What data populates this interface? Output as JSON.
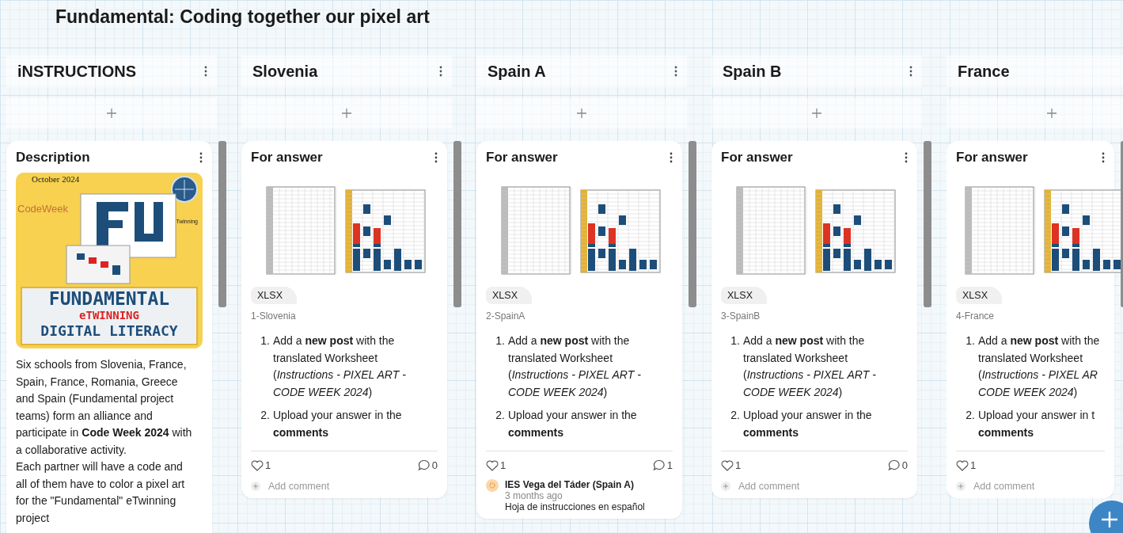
{
  "board": {
    "title": "Fundamental: Coding together our pixel art"
  },
  "columns": [
    {
      "title": "iNSTRUCTIONS",
      "posts": [
        {
          "kind": "description",
          "title": "Description",
          "poster": {
            "date": "October 2024",
            "brand": "CodeWeek",
            "badge": "Twinning",
            "headline": "FUNDAMENTAL",
            "subline": "eTWINNING",
            "footer": "DIGITAL LITERACY"
          },
          "body": "Six schools from Slovenia, France, Spain, France, Romania, Greece and Spain (Fundamental project teams) form an alliance and participate in **Code Week 2024** with a collaborative activity.\nEach partner will have a code and all of them have to color a pixel art for the \"Fundamental\" eTwinning project"
        }
      ]
    },
    {
      "title": "Slovenia",
      "posts": [
        {
          "kind": "answer",
          "title": "For answer",
          "attachment": "XLSX",
          "caption": "1-Slovenia",
          "steps": [
            {
              "number": "1.",
              "text": "Add a **new post** with the translated Worksheet (*Instructions - PIXEL ART - CODE WEEK 2024*)"
            },
            {
              "number": "2.",
              "text": "Upload your answer in the **comments**"
            }
          ],
          "likes": "1",
          "comments_count": "0",
          "comment_placeholder": "Add comment"
        }
      ]
    },
    {
      "title": "Spain A",
      "posts": [
        {
          "kind": "answer",
          "title": "For answer",
          "attachment": "XLSX",
          "caption": "2-SpainA",
          "steps": [
            {
              "number": "1.",
              "text": "Add a **new post** with the translated Worksheet (*Instructions - PIXEL ART - CODE WEEK 2024*)"
            },
            {
              "number": "2.",
              "text": "Upload your answer in the **comments**"
            }
          ],
          "likes": "1",
          "comments_count": "1",
          "comments": [
            {
              "author": "IES Vega del Táder (Spain A)",
              "time": "3 months ago",
              "text": "Hoja de instrucciones en español"
            }
          ]
        }
      ]
    },
    {
      "title": "Spain B",
      "posts": [
        {
          "kind": "answer",
          "title": "For answer",
          "attachment": "XLSX",
          "caption": "3-SpainB",
          "steps": [
            {
              "number": "1.",
              "text": "Add a **new post** with the translated Worksheet (*Instructions - PIXEL ART - CODE WEEK 2024*)"
            },
            {
              "number": "2.",
              "text": "Upload your answer in the **comments**"
            }
          ],
          "likes": "1",
          "comments_count": "0",
          "comment_placeholder": "Add comment"
        }
      ]
    },
    {
      "title": "France",
      "posts": [
        {
          "kind": "answer",
          "title": "For answer",
          "attachment": "XLSX",
          "caption": "4-France",
          "steps": [
            {
              "number": "1.",
              "text": "Add a **new post** with the translated Worksheet (*Instructions - PIXEL AR CODE WEEK 2024*)"
            },
            {
              "number": "2.",
              "text": "Upload your answer in t **comments**"
            }
          ],
          "likes": "1",
          "comment_placeholder": "Add comment"
        }
      ]
    }
  ]
}
